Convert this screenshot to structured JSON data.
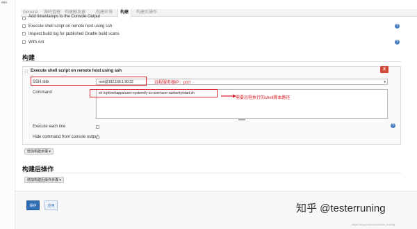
{
  "window": {
    "ghost_title": "ees"
  },
  "tabs": [
    {
      "label": "General",
      "active": false
    },
    {
      "label": "源码管理",
      "active": false
    },
    {
      "label": "构建触发器",
      "active": false
    },
    {
      "label": "构建环境",
      "active": false
    },
    {
      "label": "构建",
      "active": true
    },
    {
      "label": "构建后操作",
      "active": false
    }
  ],
  "env_options": [
    {
      "label": "Add timestamps to the Console Output",
      "checked": false
    },
    {
      "label": "Execute shell script on remote host using ssh",
      "checked": false
    },
    {
      "label": "Inspect build log for published Gradle build scans",
      "checked": false
    },
    {
      "label": "With Ant",
      "checked": false
    }
  ],
  "help_icon_glyph": "?",
  "build": {
    "section_title": "构建",
    "step": {
      "title": "Execute shell script on remote host using ssh",
      "delete_label": "X",
      "ssh_site_label": "SSH site",
      "ssh_site_value": "root@192.168.1.90:22",
      "command_label": "Command",
      "command_value": "sh /opt/webapps/user-system/ly-sx-user/user-authority/start.sh",
      "execute_each_line_label": "Execute each line",
      "hide_command_label": "Hide command from console output"
    },
    "add_step_label": "增加构建步骤 ▾"
  },
  "annotations": {
    "ssh_note": "远程服务器IP：port",
    "command_note": "需要远程执行的shell脚本路径"
  },
  "post_build": {
    "section_title": "构建后操作",
    "add_step_label": "增加构建后操作步骤 ▾"
  },
  "footer": {
    "save_label": "保存",
    "apply_label": "应用"
  },
  "watermark": "知乎 @testerruning",
  "url_watermark": "https://blog.csdn.net/weixin_testing",
  "colors": {
    "accent": "#2f6fb5",
    "annotation_red": "#d9232d",
    "delete_red": "#d24a3a",
    "help_blue": "#4a7fc1"
  }
}
